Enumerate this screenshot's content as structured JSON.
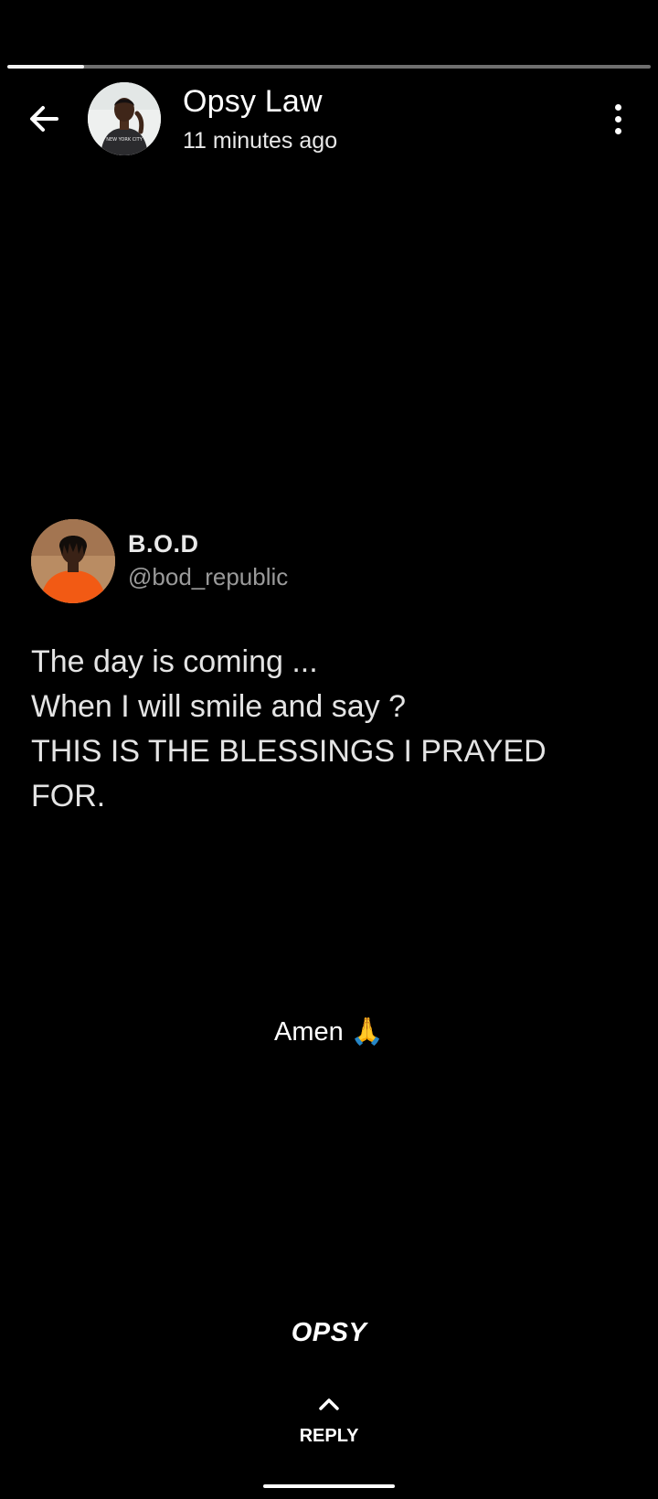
{
  "story": {
    "progress": 0.12
  },
  "header": {
    "poster_name": "Opsy Law",
    "timestamp": "11 minutes ago",
    "back_icon": "arrow-left-icon",
    "menu_icon": "more-vertical-icon",
    "avatar_shirt_text": "NEW YORK CITY"
  },
  "tweet": {
    "display_name": "B.O.D",
    "handle": "@bod_republic",
    "lines": [
      "The day is coming ...",
      "When I will smile and say ?",
      "THIS IS THE BLESSINGS I PRAYED",
      "FOR."
    ]
  },
  "caption": {
    "text": "Amen 🙏"
  },
  "signature": {
    "text": "OPSY"
  },
  "footer": {
    "reply_icon": "chevron-up-icon",
    "reply_label": "REPLY"
  },
  "colors": {
    "background": "#000000",
    "progress_track": "#6f6f6f",
    "progress_fill": "#f2f2f2",
    "handle": "#9a9a9a"
  }
}
